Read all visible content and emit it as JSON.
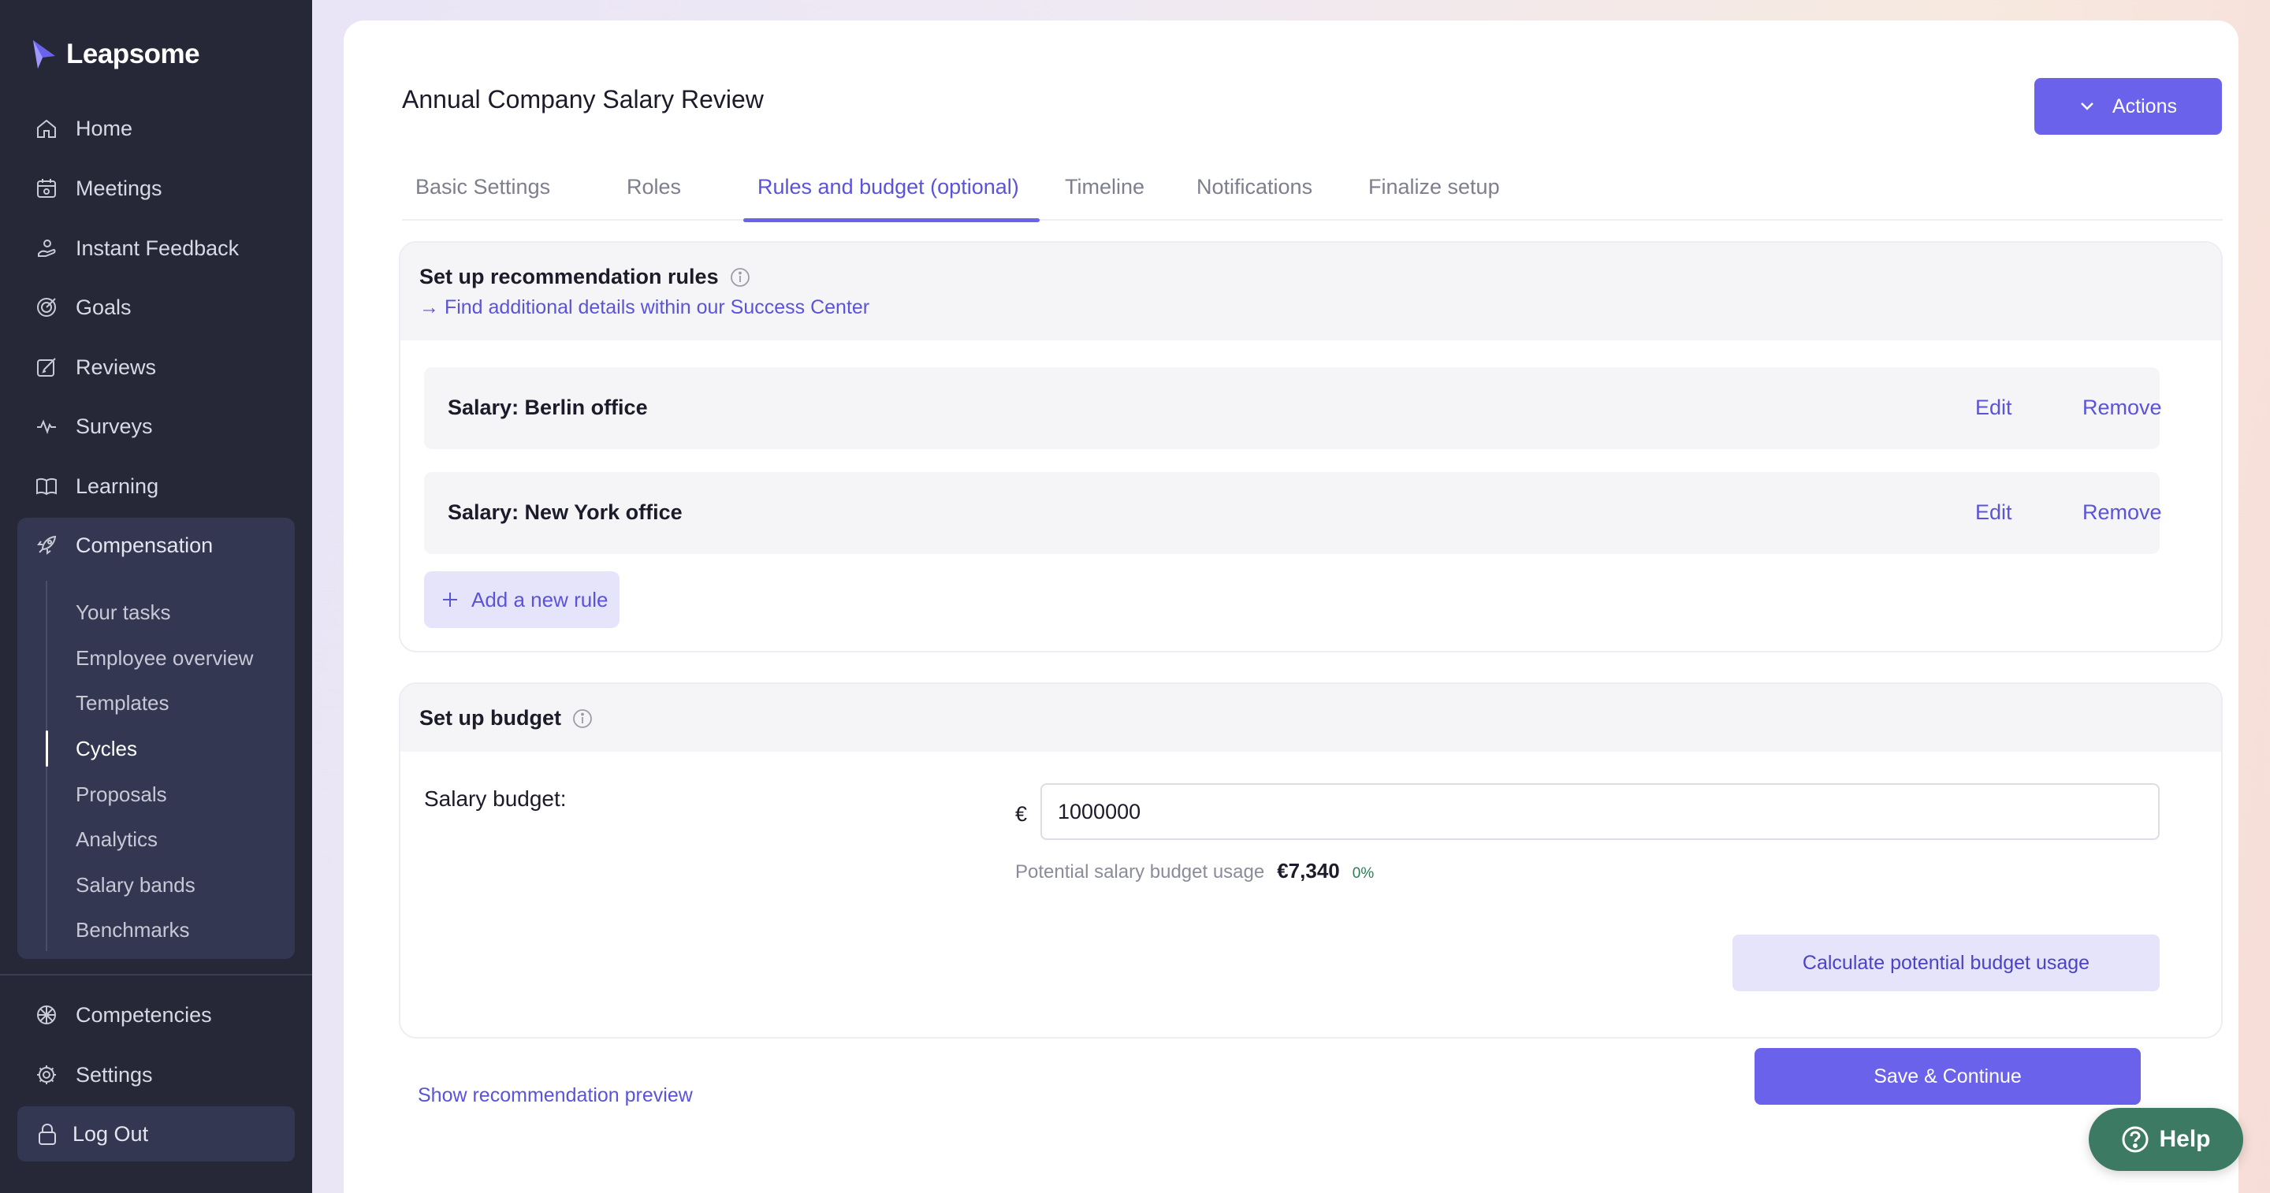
{
  "brand": {
    "name": "Leapsome"
  },
  "sidebar": {
    "items": [
      {
        "label": "Home",
        "icon": "home-icon"
      },
      {
        "label": "Meetings",
        "icon": "meetings-icon"
      },
      {
        "label": "Instant Feedback",
        "icon": "feedback-icon"
      },
      {
        "label": "Goals",
        "icon": "goals-icon"
      },
      {
        "label": "Reviews",
        "icon": "reviews-icon"
      },
      {
        "label": "Surveys",
        "icon": "surveys-icon"
      },
      {
        "label": "Learning",
        "icon": "learning-icon"
      }
    ],
    "compensation": {
      "label": "Compensation",
      "icon": "rocket-icon",
      "subitems": [
        {
          "label": "Your tasks"
        },
        {
          "label": "Employee overview"
        },
        {
          "label": "Templates"
        },
        {
          "label": "Cycles",
          "active": true
        },
        {
          "label": "Proposals"
        },
        {
          "label": "Analytics"
        },
        {
          "label": "Salary bands"
        },
        {
          "label": "Benchmarks"
        }
      ]
    },
    "bottom_items": [
      {
        "label": "Competencies",
        "icon": "competencies-icon"
      },
      {
        "label": "Settings",
        "icon": "gear-icon"
      }
    ],
    "logout": {
      "label": "Log Out",
      "icon": "lock-icon"
    }
  },
  "header": {
    "title": "Annual Company Salary Review",
    "actions_label": "Actions"
  },
  "tabs": [
    {
      "label": "Basic Settings",
      "active": false
    },
    {
      "label": "Roles",
      "active": false
    },
    {
      "label": "Rules and budget (optional)",
      "active": true
    },
    {
      "label": "Timeline",
      "active": false
    },
    {
      "label": "Notifications",
      "active": false
    },
    {
      "label": "Finalize setup",
      "active": false
    }
  ],
  "rules_section": {
    "title": "Set up recommendation rules",
    "link": "→ Find additional details within our Success Center",
    "rules": [
      {
        "name": "Salary: Berlin office",
        "edit": "Edit",
        "remove": "Remove"
      },
      {
        "name": "Salary: New York office",
        "edit": "Edit",
        "remove": "Remove"
      }
    ],
    "add_label": "Add a new rule"
  },
  "budget_section": {
    "title": "Set up budget",
    "salary_budget_label": "Salary budget:",
    "currency": "€",
    "value": "1000000",
    "usage_label": "Potential salary budget usage",
    "usage_value": "€7,340",
    "usage_percent": "0%",
    "calculate_label": "Calculate potential budget usage"
  },
  "footer": {
    "preview_link": "Show recommendation preview",
    "save_label": "Save & Continue"
  },
  "help": {
    "label": "Help"
  },
  "colors": {
    "accent": "#6a62ea",
    "sidebar_bg": "#262838",
    "link": "#5b53d8",
    "help_bg": "#3c7a63"
  }
}
